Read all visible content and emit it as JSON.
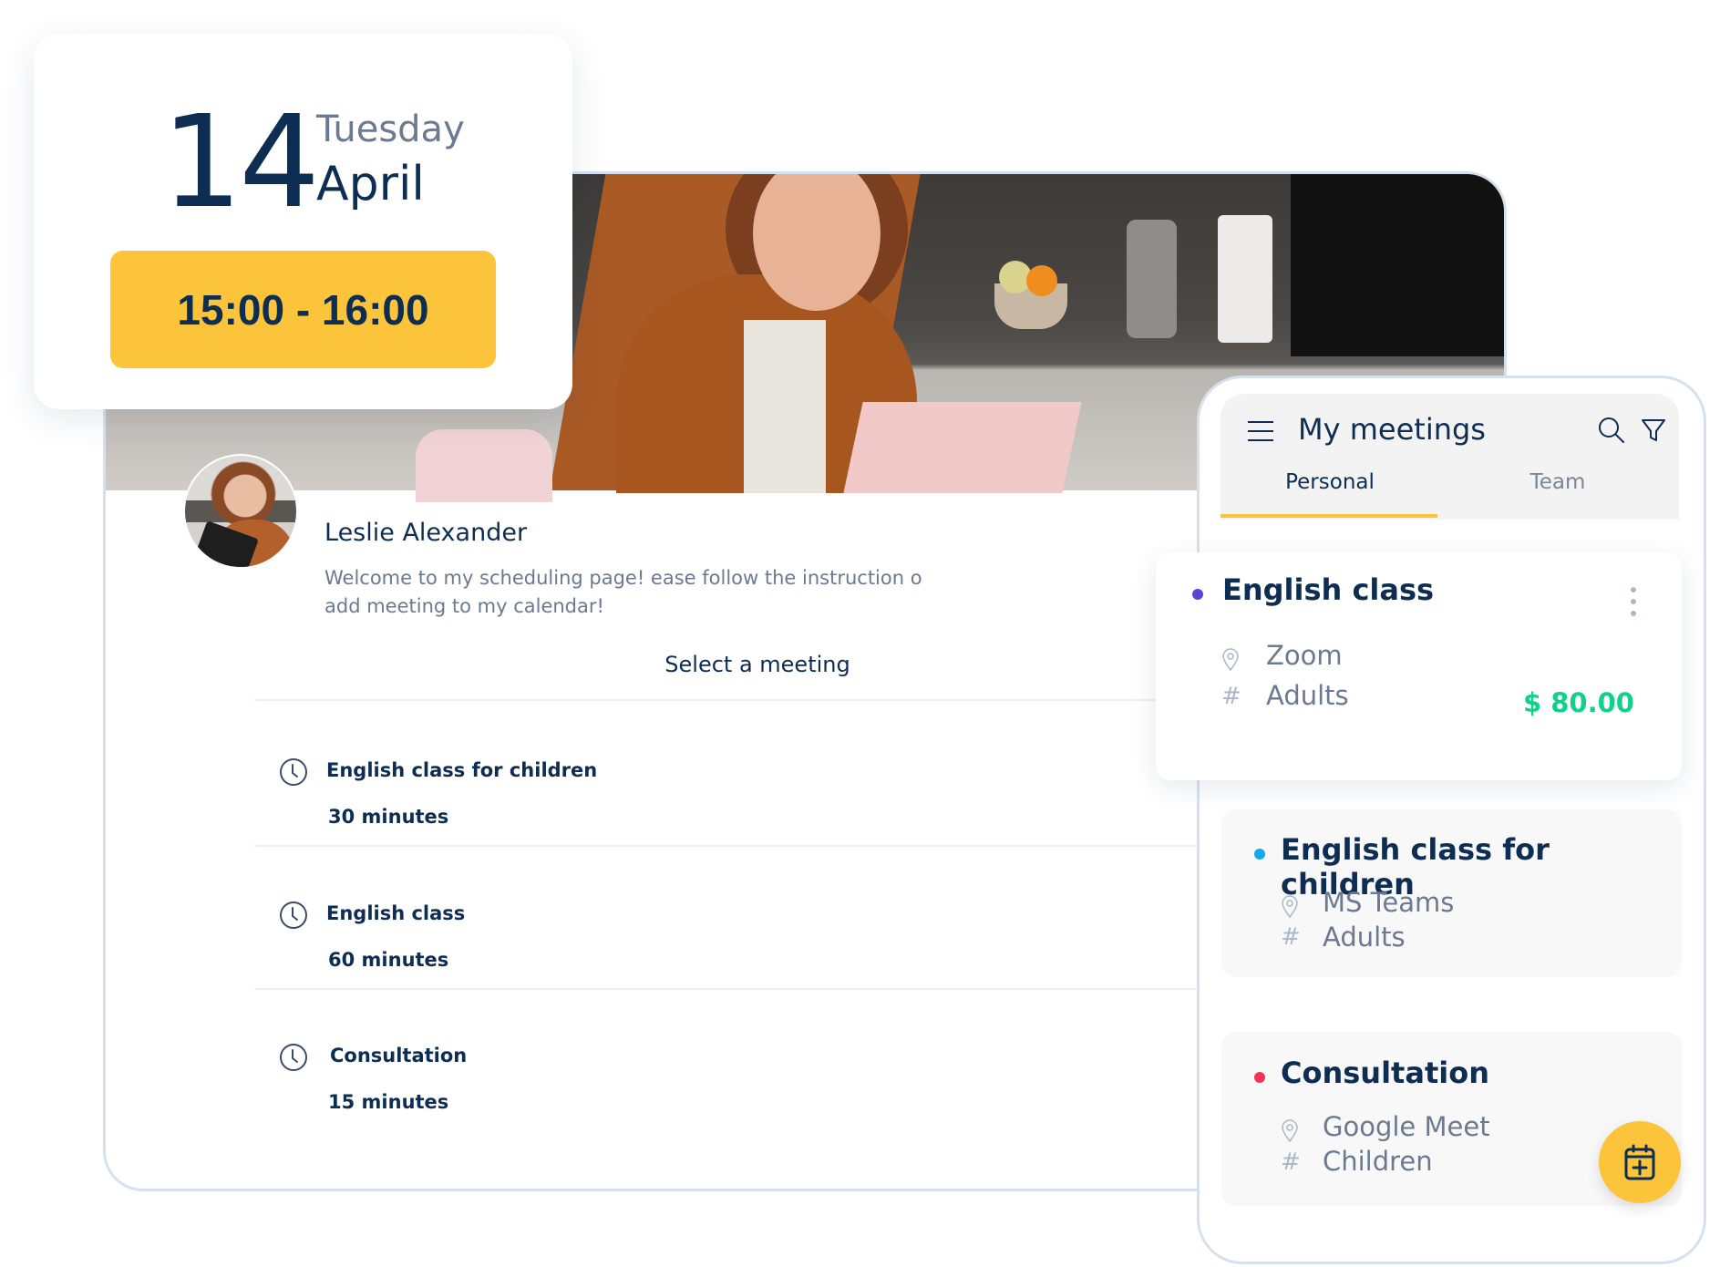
{
  "date_card": {
    "day": "14",
    "weekday": "Tuesday",
    "month": "April",
    "time_range": "15:00 - 16:00"
  },
  "profile": {
    "name": "Leslie Alexander",
    "description": "Welcome to my scheduling page! ease follow the instruction o add  meeting to my calendar!"
  },
  "booking": {
    "select_title": "Select a meeting",
    "meetings": [
      {
        "title": "English class for children",
        "duration": "30 minutes",
        "icon": "clock-icon"
      },
      {
        "title": "English class",
        "duration": "60 minutes",
        "icon": "clock-icon"
      },
      {
        "title": "Consultation",
        "duration": "15 minutes",
        "icon": "clock-icon"
      }
    ]
  },
  "phone": {
    "title": "My meetings",
    "icons": {
      "menu": "hamburger-icon",
      "search": "search-icon",
      "filter": "filter-icon",
      "fab": "calendar-add-icon"
    },
    "tabs": [
      {
        "label": "Personal",
        "active": true
      },
      {
        "label": "Team",
        "active": false
      }
    ],
    "cards": [
      {
        "title": "English class",
        "location": "Zoom",
        "tag": "Adults",
        "price": "$ 80.00",
        "dot_color": "#5b43d6",
        "selected": true
      },
      {
        "title": "English class for children",
        "location": "MS Teams",
        "tag": "Adults",
        "dot_color": "#13a9ec"
      },
      {
        "title": "Consultation",
        "location": "Google Meet",
        "tag": "Children",
        "dot_color": "#f5325a"
      }
    ],
    "hash_symbol": "#"
  },
  "colors": {
    "accent_yellow": "#fcc43a",
    "navy": "#0e2d52",
    "price_green": "#12d08a",
    "muted": "#6b7a90"
  }
}
